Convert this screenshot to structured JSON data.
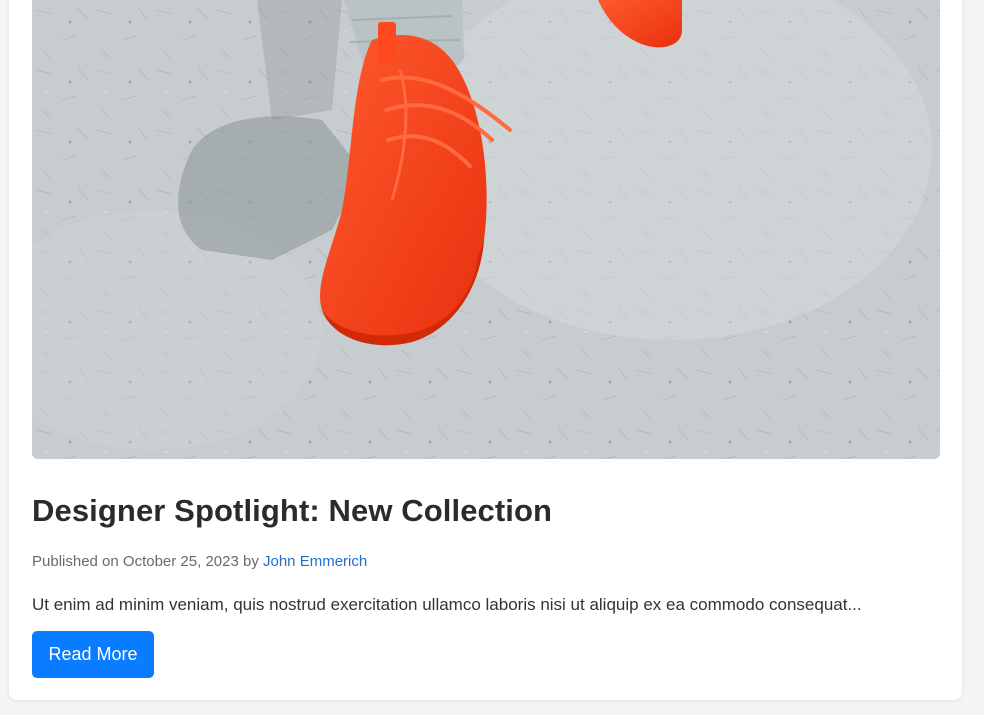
{
  "post": {
    "image_alt": "Red knit sneakers on a concrete floor",
    "title": "Designer Spotlight: New Collection",
    "meta_prefix": "Published on October 25, 2023 by ",
    "author": "John Emmerich",
    "excerpt": "Ut enim ad minim veniam, quis nostrud exercitation ullamco laboris nisi ut aliquip ex ea commodo consequat...",
    "read_more_label": "Read More"
  },
  "colors": {
    "accent": "#0a7cff",
    "author_link": "#1f6fd1",
    "shoe": "#ff3b17"
  }
}
